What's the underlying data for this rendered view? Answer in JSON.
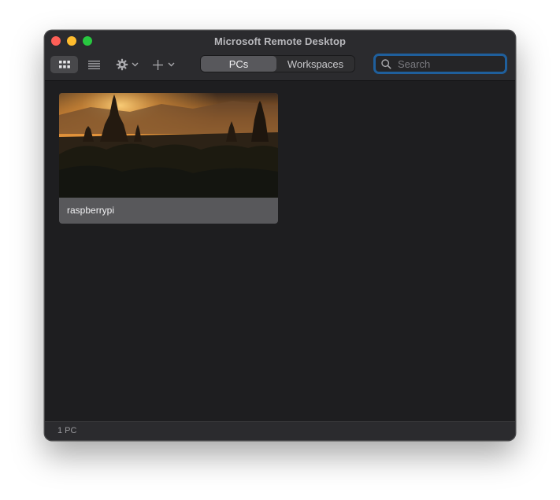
{
  "window": {
    "title": "Microsoft Remote Desktop"
  },
  "toolbar": {
    "view_grid_icon": "grid-icon",
    "view_list_icon": "list-icon",
    "settings_icon": "gear-icon",
    "add_icon": "plus-icon",
    "segments": [
      {
        "label": "PCs",
        "selected": true
      },
      {
        "label": "Workspaces",
        "selected": false
      }
    ]
  },
  "search": {
    "placeholder": "Search",
    "value": ""
  },
  "pcs": [
    {
      "name": "raspberrypi",
      "thumbnail": "sunset-temple-landscape"
    }
  ],
  "status": {
    "text": "1 PC"
  },
  "colors": {
    "traffic_red": "#fe5f57",
    "traffic_yellow": "#febc2e",
    "traffic_green": "#28c840",
    "focus_ring": "#1f5f9c"
  }
}
